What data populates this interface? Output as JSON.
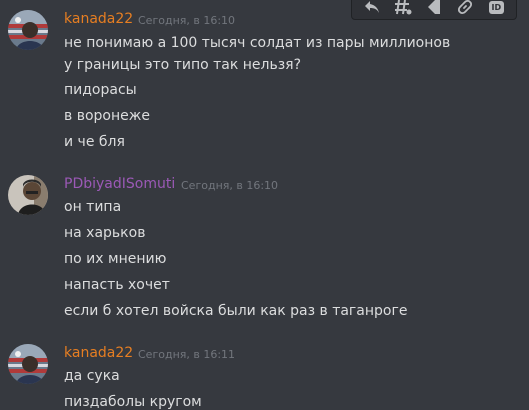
{
  "colors": {
    "background": "#36393f",
    "username_kanada": "#e67e22",
    "username_pdbiyad": "#9b59b6",
    "text": "#dcddde",
    "timestamp": "#72767d"
  },
  "hover_toolbar": {
    "icons": [
      "reply-icon",
      "thread-icon",
      "mark-unread-icon",
      "copy-link-icon",
      "copy-id-icon"
    ],
    "id_label": "ID"
  },
  "messages": [
    {
      "author": "kanada22",
      "author_color": "#e67e22",
      "timestamp": "Сегодня, в 16:10",
      "lines": [
        "не понимаю а 100 тысяч солдат из пары миллионов у границы это типо так нельзя?",
        "пидорасы",
        "в воронеже",
        "и че бля"
      ]
    },
    {
      "author": "PDbiyadISomuti",
      "author_color": "#9b59b6",
      "timestamp": "Сегодня, в 16:10",
      "lines": [
        "он типа",
        "на харьков",
        "по их мнению",
        "напасть хочет",
        "если б хотел войска были как раз в таганроге"
      ]
    },
    {
      "author": "kanada22",
      "author_color": "#e67e22",
      "timestamp": "Сегодня, в 16:11",
      "lines": [
        "да сука",
        "пиздаболы кругом"
      ]
    }
  ]
}
